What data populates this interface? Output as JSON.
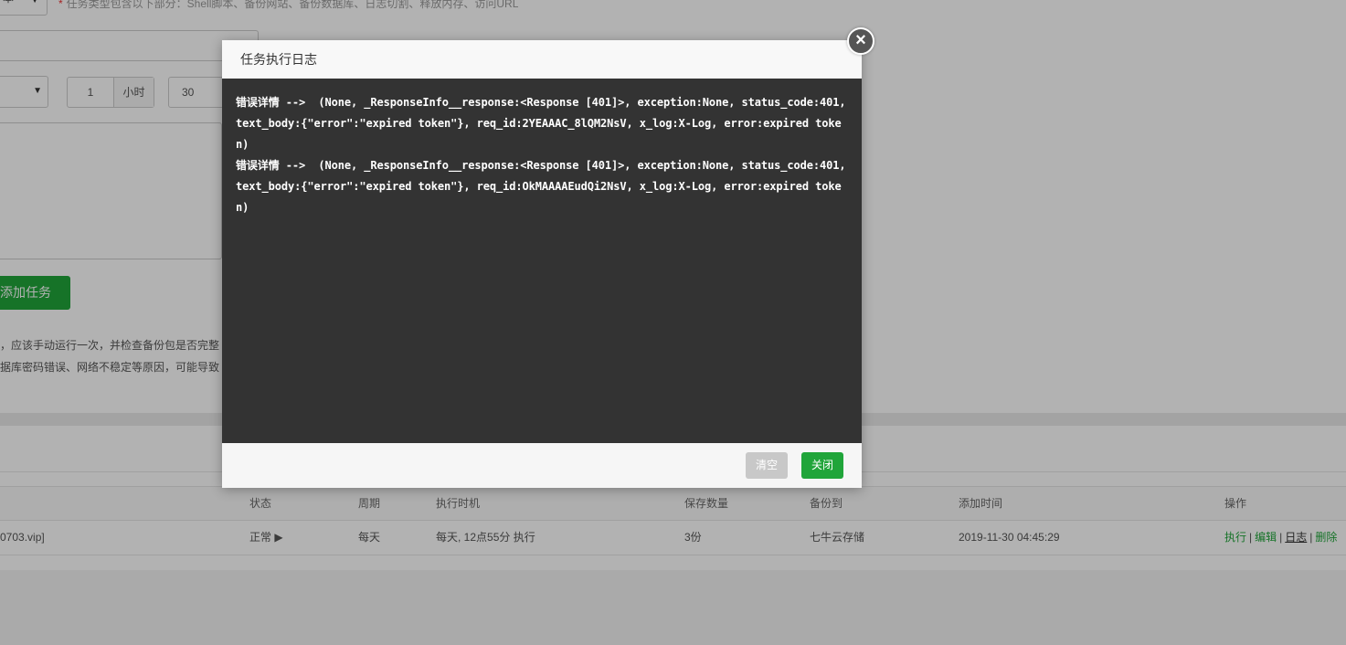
{
  "background": {
    "type_select": {
      "value": "本"
    },
    "hint": {
      "star": "*",
      "text": "任务类型包含以下部分：Shell脚本、备份网站、备份数据库、日志切割、释放内存、访问URL"
    },
    "hour_value": "1",
    "hour_unit": "小时",
    "minute_value": "30",
    "add_task_label": "添加任务",
    "tips": [
      "，应该手动运行一次，并检查备份包是否完整",
      "据库密码错误、网络不稳定等原因，可能导致"
    ],
    "table": {
      "headers": {
        "status": "状态",
        "cycle": "周期",
        "exec_time": "执行时机",
        "keep": "保存数量",
        "backup_to": "备份到",
        "add_time": "添加时间",
        "ops": "操作"
      },
      "rows": [
        {
          "name": "0703.vip]",
          "status": "正常",
          "status_icon": "▶",
          "cycle": "每天",
          "exec_time": "每天, 12点55分 执行",
          "keep": "3份",
          "backup_to": "七牛云存储",
          "add_time": "2019-11-30 04:45:29",
          "op_exec": "执行",
          "op_edit": "编辑",
          "op_log": "日志",
          "op_delete": "删除",
          "sep": "|"
        }
      ]
    }
  },
  "modal": {
    "title": "任务执行日志",
    "close_icon": "×",
    "log_lines": [
      "错误详情 -->  (None, _ResponseInfo__response:<Response [401]>, exception:None, status_code:401, text_body:{\"error\":\"expired token\"}, req_id:2YEAAAC_8lQM2NsV, x_log:X-Log, error:expired token)",
      "错误详情 -->  (None, _ResponseInfo__response:<Response [401]>, exception:None, status_code:401, text_body:{\"error\":\"expired token\"}, req_id:OkMAAAAEudQi2NsV, x_log:X-Log, error:expired token)"
    ],
    "clear_label": "清空",
    "close_label": "关闭"
  },
  "colors": {
    "primary_green": "#20a53a",
    "log_background": "#333333",
    "overlay": "rgba(0,0,0,0.3)"
  }
}
